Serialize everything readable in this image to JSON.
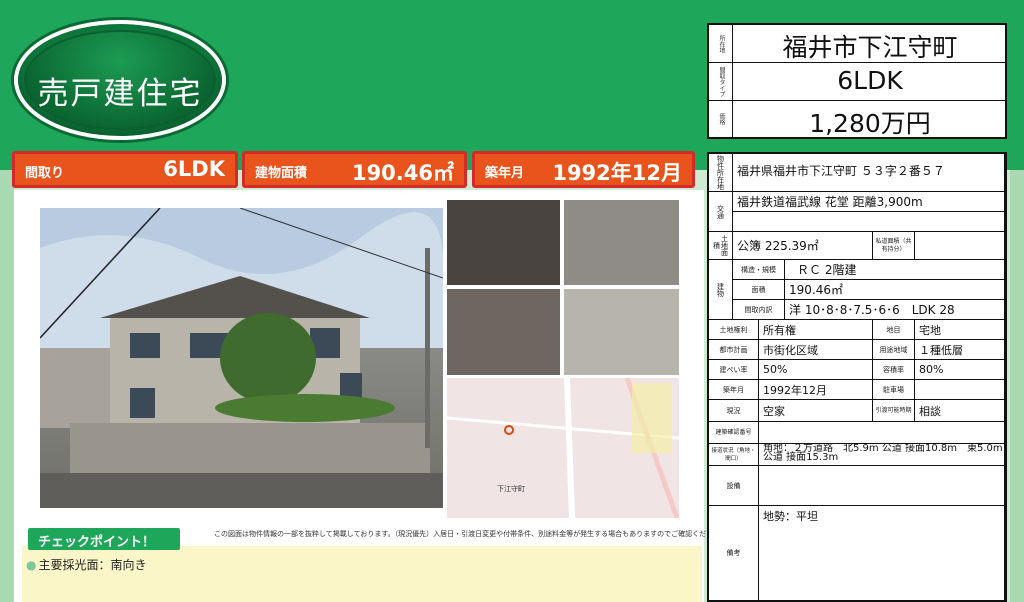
{
  "badge": {
    "title": "売戸建住宅"
  },
  "tags": [
    {
      "label": "間取り",
      "value": "6LDK"
    },
    {
      "label": "建物面積",
      "value": "190.46㎡"
    },
    {
      "label": "築年月",
      "value": "1992年12月"
    }
  ],
  "summary": {
    "location_key": "所在地",
    "location": "福井市下江守町",
    "layout_key": "間取タイプ",
    "layout": "6LDK",
    "price_key": "価格",
    "price": "1,280万円"
  },
  "spec": {
    "address_key": "物件所在地",
    "address": "福井県福井市下江守町 ５３字２番５７",
    "transport_key": "交通",
    "transport": "福井鉄道福武線 花堂 距離3,900m",
    "land_area_key": "土地面積",
    "land_area": "公簿 225.39㎡",
    "private_road_key": "私道面積（共有持分）",
    "building_key": "建物",
    "structure_key": "構造・規模",
    "structure": "ＲＣ 2階建",
    "floor_area_key": "面積",
    "floor_area": "190.46㎡",
    "rooms_key": "間取内訳",
    "rooms": "洋 10･8･8･7.5･6･6　LDK 28",
    "land_right_key": "土地権利",
    "land_right": "所有権",
    "land_cat_key": "地目",
    "land_cat": "宅地",
    "city_plan_key": "都市計画",
    "city_plan": "市街化区域",
    "zoning_key": "用途地域",
    "zoning": "１種低層",
    "bcr_key": "建ぺい率",
    "bcr": "50%",
    "far_key": "容積率",
    "far": "80%",
    "built_key": "築年月",
    "built": "1992年12月",
    "parking_key": "駐車場",
    "current_key": "現況",
    "current": "空家",
    "handover_key": "引渡可能時期",
    "handover": "相談",
    "confirm_key": "建築確認番号",
    "road_key": "接道状況（角地・間口）",
    "road_line1": "角地：２方道路　北5.9m 公道 接面10.8m　東5.0m",
    "road_line2": "公道 接面15.3m",
    "equip_key": "設備",
    "remarks_key": "備考",
    "remarks": "地勢：平坦"
  },
  "checkpoint": {
    "title": "チェックポイント！",
    "item": "主要採光面：南向き"
  },
  "disclaimer": "この図面は物件情報の一部を抜粋して掲載しております。（現況優先）入居日・引渡日変更や付帯条件、別途料金等が発生する場合もありますのでご確認ください。",
  "map": {
    "label": "下江守町"
  },
  "colors": {
    "green": "#1ea75a",
    "orange": "#e8541b",
    "red_border": "#d32a2a"
  }
}
